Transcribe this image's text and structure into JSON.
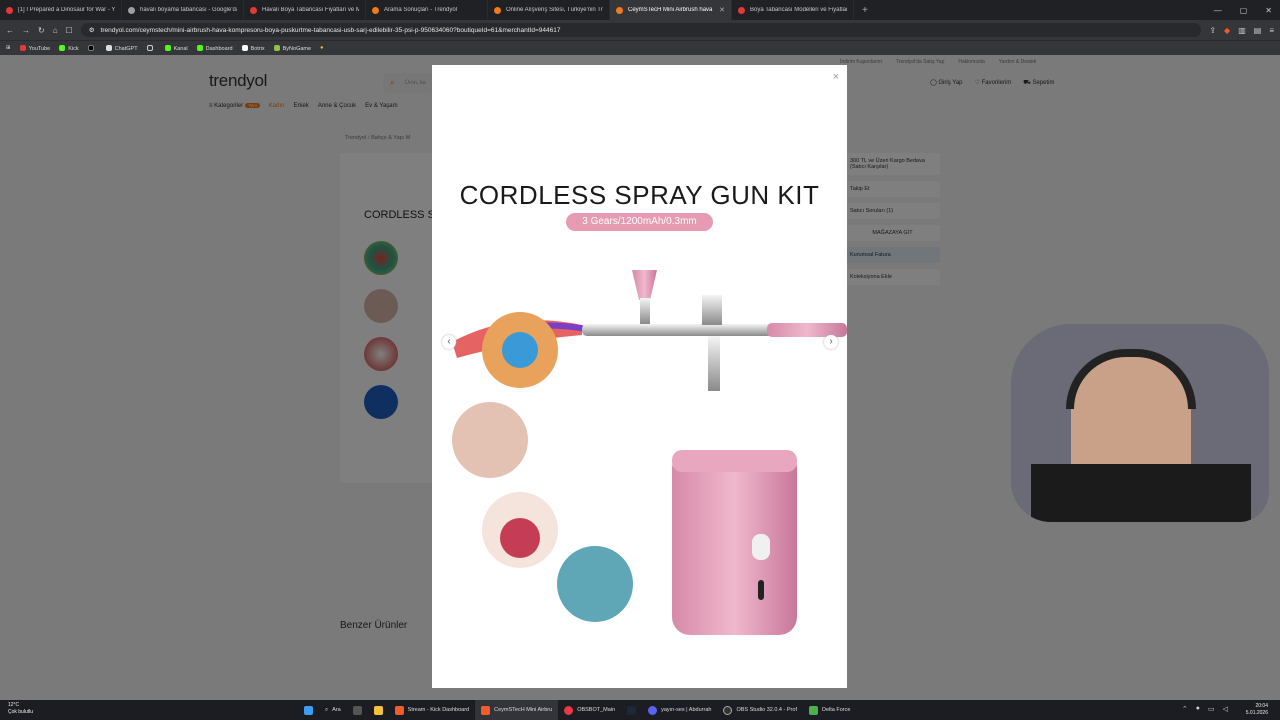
{
  "browser": {
    "tabs": [
      {
        "title": "[1] I Prepared a Dinosaur for War - Y",
        "color": "#e53935"
      },
      {
        "title": "havalı boyama tabancası - Google'da",
        "color": "#9e9e9e"
      },
      {
        "title": "Havalı Boya Tabancası Fiyatları ve Mo",
        "color": "#e53935"
      },
      {
        "title": "Arama Sonuçları - Trendyol",
        "color": "#f27a1a"
      },
      {
        "title": "Online Alışveriş Sitesi, Türkiye'nin Tre",
        "color": "#f27a1a"
      },
      {
        "title": "CeymSTecH Mini Airbrush hava",
        "color": "#f27a1a",
        "active": true
      },
      {
        "title": "Boya Tabancası Modelleri ve Fiyatları",
        "color": "#e53935"
      }
    ],
    "new_tab": "+",
    "url": "trendyol.com/ceymstech/mini-airbrush-hava-kompresoru-boya-puskurtme-tabancasi-usb-sarj-edilebilir-35-psi-p-950634060?boutiqueId=61&merchantId=944617",
    "bookmarks": [
      "YouTube",
      "Kick",
      "ChatGPT",
      "Kanal",
      "Dashboard",
      "Botrix",
      "ByNoGame"
    ]
  },
  "site": {
    "logo": "trendyol",
    "search_placeholder": "Ürün, ka",
    "top_links": [
      "İndirim Kuponlarım",
      "Trendyol'da Satış Yap",
      "Hakkımızda",
      "Yardım & Destek"
    ],
    "account": {
      "login": "Giriş Yap",
      "favorites": "Favorilerim",
      "cart": "Sepetim"
    },
    "categories": [
      "Kategoriler",
      "Kadın",
      "Erkek",
      "Anne & Çocuk",
      "Ev & Yaşam"
    ],
    "new_badge": "Yeni",
    "breadcrumb": "Trendyol  ›  Bahçe & Yapı M",
    "product_name_partial": "CORDLESS S",
    "similar_title": "Benzer Ürünler",
    "side": {
      "shipping": "300 TL ve Üzeri Kargo Bedava (Satıcı Karşılar)",
      "follow": "Takip Et",
      "seller_questions": "Satıcı Soruları (1)",
      "store_button": "MAĞAZAYA GİT",
      "invoice": "Kurumsal Fatura",
      "collection": "Koleksiyona Ekle"
    }
  },
  "modal": {
    "close": "×",
    "title": "CORDLESS SPRAY GUN KIT",
    "subtitle": "3 Gears/1200mAh/0.3mm",
    "prev": "‹",
    "next": "›"
  },
  "taskbar": {
    "weather_temp": "12°C",
    "weather_desc": "Çok bulutlu",
    "search": "Ara",
    "apps": [
      "Stream - Kick Dashboard",
      "CeymSTecH Mini Airbru",
      "OBSBOT_Main",
      "yayın-ses | Abdurrah",
      "OBS Studio 32.0.4 - Prof",
      "Delta Force"
    ],
    "time": "20:04",
    "date": "5.01.2026"
  }
}
